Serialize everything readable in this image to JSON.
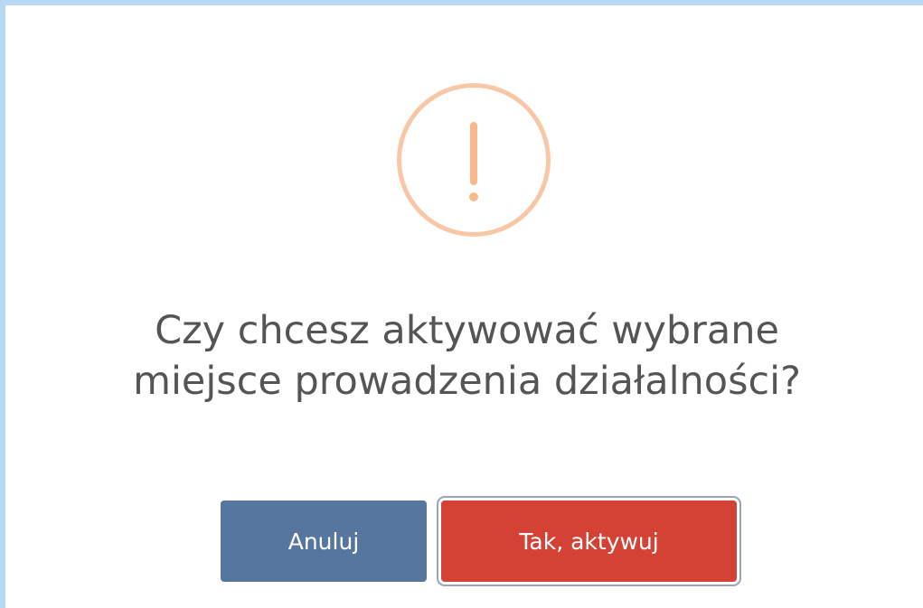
{
  "dialog": {
    "icon": "exclamation-warning-icon",
    "title_line1": "Czy chcesz aktywować wybrane",
    "title_line2": "miejsce prowadzenia działalności?",
    "cancel_label": "Anuluj",
    "confirm_label": "Tak, aktywuj"
  },
  "colors": {
    "frame_border": "#b9d8f4",
    "icon_accent": "#f8c8a6",
    "title_text": "#555555",
    "cancel_bg": "#5676a0",
    "confirm_bg": "#d34235"
  }
}
